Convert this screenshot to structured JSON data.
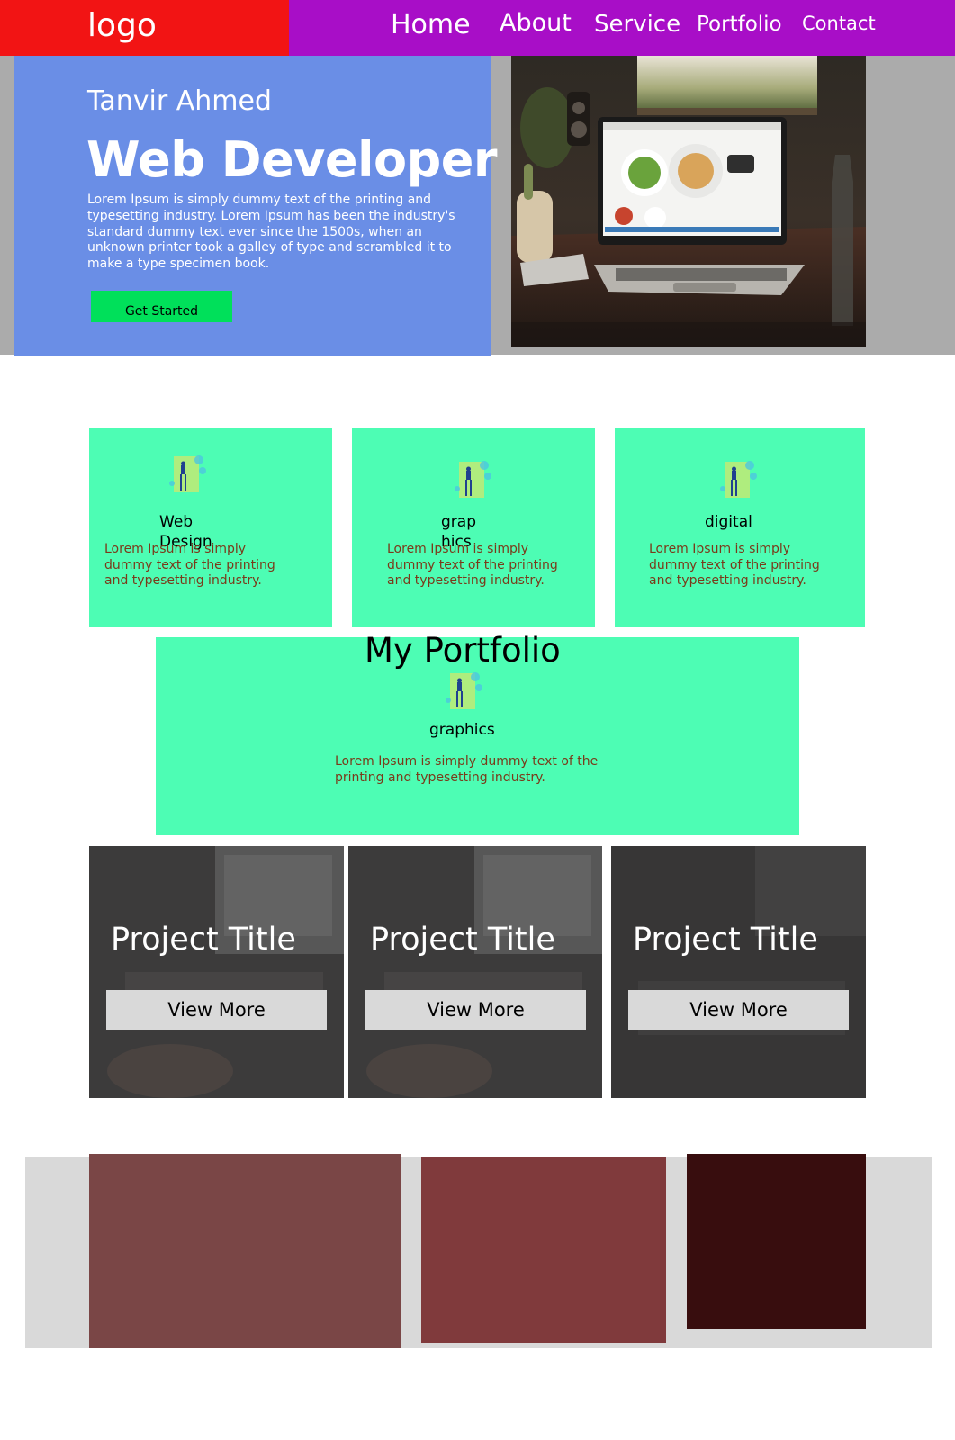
{
  "header": {
    "logo": "logo",
    "nav": [
      "Home",
      "About",
      "Service",
      "Portfolio",
      "Contact"
    ]
  },
  "hero": {
    "name": "Tanvir Ahmed",
    "title": "Web Developer",
    "text": "Lorem Ipsum is simply dummy text of the printing and typesetting industry. Lorem Ipsum has been the industry's standard dummy text ever since the 1500s, when an unknown printer took a galley of type and scrambled it to make a type specimen book.",
    "button": "Get Started"
  },
  "services": [
    {
      "title": "Web Design",
      "text": "Lorem Ipsum is simply dummy text of the printing and typesetting industry."
    },
    {
      "title": "graphics",
      "text": "Lorem Ipsum is simply dummy text of the printing and typesetting industry."
    },
    {
      "title": "digital",
      "text": "Lorem Ipsum is simply dummy text of the printing and typesetting industry."
    }
  ],
  "portfolio": {
    "heading": "My Portfolio",
    "card": {
      "title": "graphics",
      "text": "Lorem Ipsum is simply dummy text of the printing and typesetting industry."
    }
  },
  "projects": [
    {
      "title": "Project Title",
      "button": "View More"
    },
    {
      "title": "Project Title",
      "button": "View More"
    },
    {
      "title": "Project Title",
      "button": "View More"
    }
  ],
  "colors": {
    "logo_bg": "#f21414",
    "nav_bg": "#a80ec7",
    "hero_bg": "#6a8ee6",
    "button_green": "#00e05a",
    "card_mint": "#4dfdb4",
    "block_1": "#7a4646",
    "block_2": "#803a3c",
    "block_3": "#380d0e"
  }
}
